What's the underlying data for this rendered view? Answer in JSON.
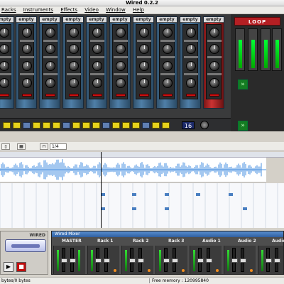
{
  "window": {
    "title": "Wired 0.2.2"
  },
  "menu": {
    "items": [
      "Racks",
      "Instruments",
      "Effects",
      "Video",
      "Window",
      "Help"
    ]
  },
  "rack": {
    "plugin_brand": "empty",
    "plugins_count": 9,
    "seq_display": "16"
  },
  "looper": {
    "name": "LOOP"
  },
  "sequencer": {
    "zoom_value": "1/4"
  },
  "mixer": {
    "title": "Wired Mixer",
    "channels": [
      "MASTER",
      "Rack 1",
      "Rack 2",
      "Rack 3",
      "Audio 1",
      "Audio 2",
      "Audio"
    ]
  },
  "transport": {
    "logo": "WIRED"
  },
  "status": {
    "left": "bytes/0 bytes",
    "right": "Free memory : 120995840"
  },
  "colors": {
    "plugin_blue": "#4f7fa8",
    "plugin_red": "#cc3333",
    "step_yellow": "#e6d21c",
    "waveform": "#4a90e2",
    "record_red": "#c10d0d"
  }
}
